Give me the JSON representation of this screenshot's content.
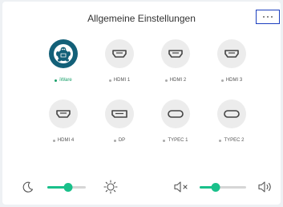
{
  "header": {
    "title": "Allgemeine Einstellungen"
  },
  "menu_icon": "more-dots-icon",
  "sources": [
    {
      "label": "iWare",
      "icon": "iware-logo-icon",
      "active": true
    },
    {
      "label": "HDMI 1",
      "icon": "hdmi-port-icon",
      "active": false
    },
    {
      "label": "HDMI 2",
      "icon": "hdmi-port-icon",
      "active": false
    },
    {
      "label": "HDMI 3",
      "icon": "hdmi-port-icon",
      "active": false
    },
    {
      "label": "HDMI 4",
      "icon": "hdmi-port-icon",
      "active": false
    },
    {
      "label": "DP",
      "icon": "displayport-icon",
      "active": false
    },
    {
      "label": "TYPEC 1",
      "icon": "usb-c-icon",
      "active": false
    },
    {
      "label": "TYPEC 2",
      "icon": "usb-c-icon",
      "active": false
    }
  ],
  "brightness": {
    "level": 0.55,
    "min_icon": "moon-icon",
    "max_icon": "sun-icon"
  },
  "volume": {
    "level": 0.35,
    "min_icon": "volume-mute-icon",
    "max_icon": "volume-high-icon"
  },
  "colors": {
    "accent": "#19c08a",
    "active_text": "#19a06a",
    "active_circle": "#136078",
    "highlight_border": "#1c3fbf"
  }
}
